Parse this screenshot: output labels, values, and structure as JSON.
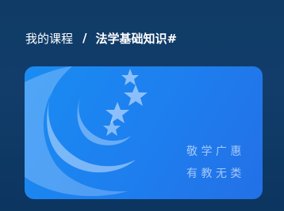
{
  "breadcrumb": {
    "parent_label": "我的课程",
    "separator": "/",
    "current_label": "法学基础知识#"
  },
  "course_card": {
    "logo_icon": "moon-stars-icon",
    "motto_line_1": "敬 学 广 惠",
    "motto_line_2": "有 教 无 类"
  },
  "colors": {
    "page_background": "#123d6b",
    "card_background": "#1e7eee",
    "text": "#ffffff"
  }
}
